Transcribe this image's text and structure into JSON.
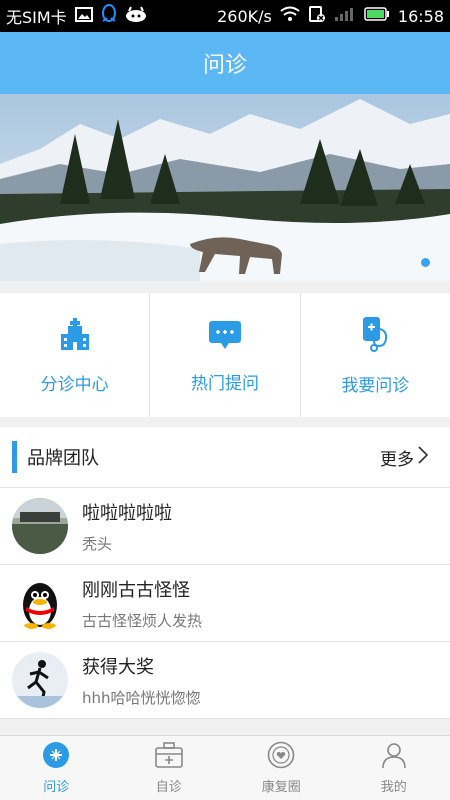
{
  "statusbar": {
    "carrier": "无SIM卡",
    "speed": "260K/s",
    "time": "16:58"
  },
  "header": {
    "title": "问诊"
  },
  "quick_actions": [
    {
      "label": "分诊中心",
      "icon": "hospital-icon"
    },
    {
      "label": "热门提问",
      "icon": "chat-bubble-icon"
    },
    {
      "label": "我要问诊",
      "icon": "phone-stethoscope-icon"
    }
  ],
  "brand_section": {
    "title": "品牌团队",
    "more": "更多"
  },
  "doctors": [
    {
      "name": "啦啦啦啦啦",
      "desc": "秃头"
    },
    {
      "name": "刚刚古古怪怪",
      "desc": "古古怪怪烦人发热"
    },
    {
      "name": "获得大奖",
      "desc": "hhh哈哈恍恍惚惚"
    }
  ],
  "tabs": [
    {
      "label": "问诊",
      "active": true
    },
    {
      "label": "自诊",
      "active": false
    },
    {
      "label": "康复圈",
      "active": false
    },
    {
      "label": "我的",
      "active": false
    }
  ],
  "colors": {
    "accent": "#2b9be6",
    "header": "#5bb8f5"
  }
}
